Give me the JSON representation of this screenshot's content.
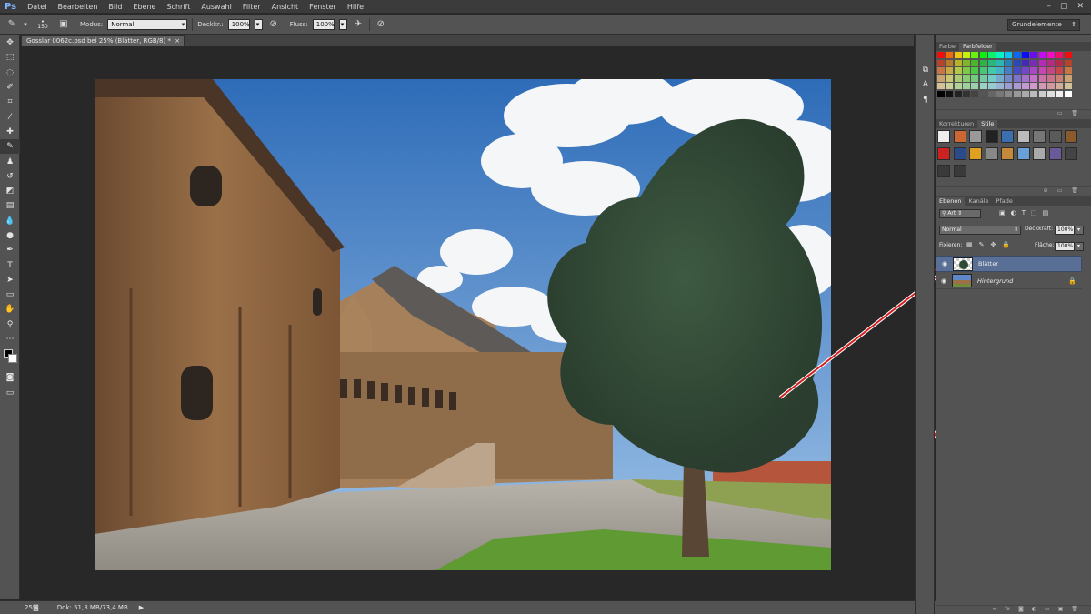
{
  "app": {
    "logo": "Ps"
  },
  "menu": [
    "Datei",
    "Bearbeiten",
    "Bild",
    "Ebene",
    "Schrift",
    "Auswahl",
    "Filter",
    "Ansicht",
    "Fenster",
    "Hilfe"
  ],
  "window_controls": [
    "–",
    "▢",
    "✕"
  ],
  "options": {
    "brush_size": "150",
    "modus_label": "Modus:",
    "modus_value": "Normal",
    "deckkraft_label": "Deckkr.:",
    "deckkraft_value": "100%",
    "fluss_label": "Fluss:",
    "fluss_value": "100%",
    "workspace": "Grundelemente"
  },
  "document": {
    "tab_title": "Gosslar 0062c.psd bei 25% (Blätter, RGB/8) *",
    "close": "×"
  },
  "status": {
    "zoom": "25%",
    "doc": "Dok: 51,3 MB/73,4 MB",
    "arrow": "▶"
  },
  "toolbar_icons": [
    "move-icon",
    "marquee-icon",
    "lasso-icon",
    "quick-select-icon",
    "crop-icon",
    "eyedropper-icon",
    "healing-icon",
    "brush-icon",
    "stamp-icon",
    "history-brush-icon",
    "eraser-icon",
    "gradient-icon",
    "blur-icon",
    "dodge-icon",
    "pen-icon",
    "type-icon",
    "path-select-icon",
    "shape-icon",
    "hand-icon",
    "zoom-icon"
  ],
  "panels": {
    "swatches_tabs": [
      "Farbe",
      "Farbfelder"
    ],
    "styles_tabs": [
      "Korrekturen",
      "Stile"
    ],
    "layers_tabs": [
      "Ebenen",
      "Kanäle",
      "Pfade"
    ],
    "filter_kind": "Art",
    "blend_mode": "Normal",
    "opacity_label": "Deckkraft:",
    "opacity_value": "100%",
    "lock_label": "Fixieren:",
    "fill_label": "Fläche:",
    "fill_value": "100%",
    "layers": [
      {
        "name": "Blätter",
        "selected": true,
        "visible": true
      },
      {
        "name": "Hintergrund",
        "selected": false,
        "visible": true,
        "locked": true
      }
    ]
  },
  "colors": {
    "accent": "#5a6f95",
    "annotation_arrow": "#d21f1f"
  }
}
